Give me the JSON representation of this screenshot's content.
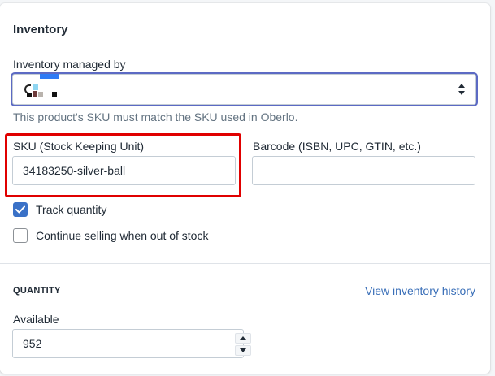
{
  "inventory": {
    "title": "Inventory",
    "managed_by_label": "Inventory managed by",
    "managed_by_value": "",
    "sku_help_text": "This product's SKU must match the SKU used in Oberlo.",
    "sku_label": "SKU (Stock Keeping Unit)",
    "sku_value": "34183250-silver-ball",
    "barcode_label": "Barcode (ISBN, UPC, GTIN, etc.)",
    "barcode_value": "",
    "track_quantity_label": "Track quantity",
    "track_quantity_checked": true,
    "continue_selling_label": "Continue selling when out of stock",
    "continue_selling_checked": false
  },
  "quantity": {
    "heading": "QUANTITY",
    "history_link": "View inventory history",
    "available_label": "Available",
    "available_value": "952"
  },
  "colors": {
    "focus_ring": "#5c6ac4",
    "highlight_border": "#e00000",
    "checkbox_checked": "#3a71c7",
    "link": "#3a6fb8"
  },
  "icons": {
    "select_arrows": "select-arrows-icon",
    "checkmark": "checkmark-icon",
    "stepper_up": "caret-up-icon",
    "stepper_down": "caret-down-icon"
  }
}
